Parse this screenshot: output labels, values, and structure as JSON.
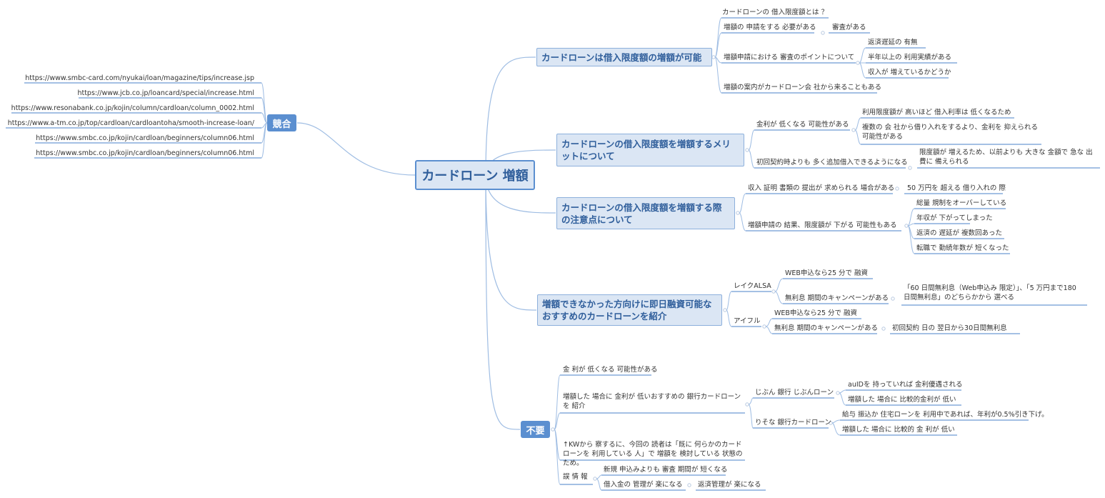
{
  "root": {
    "label": "カードローン 増額"
  },
  "competitors": {
    "label": "競合",
    "urls": [
      "https://www.smbc-card.com/nyukai/loan/magazine/tips/increase.jsp",
      "https://www.jcb.co.jp/loancard/special/increase.html",
      "https://www.resonabank.co.jp/kojin/column/cardloan/column_0002.html",
      "https://www.a-tm.co.jp/top/cardloan/cardloantoha/smooth-increase-loan/",
      "https://www.smbc.co.jp/kojin/cardloan/beginners/column06.html",
      "https://www.smbc.co.jp/kojin/cardloan/beginners/column06.html"
    ]
  },
  "b1": {
    "label": "カードローンは借入限度額の増額が可能",
    "items": [
      "カードローンの 借入限度額とは ？",
      "増額の 申請をする 必要がある",
      "審査がある",
      "増額申請における 審査のポイントについて",
      "返済遅延の 有無",
      "半年以上の 利用実績がある",
      "収入が 増えているかどうか",
      "増額の案内がカードローン会 社から来ることもある"
    ]
  },
  "b2": {
    "label": "カードローンの借入限度額を増額するメリットについて",
    "items": [
      "金利が 低くなる 可能性がある",
      "利用限度額が 高いほど 借入利率は 低くなるため",
      "複数の 会 社から借り入れをするより、金利を 抑えられる 可能性がある",
      "初回契約時よりも 多く追加借入できるようになる",
      "限度額が 増えるため、以前よりも 大きな 金額で 急な 出費に 備えられる"
    ]
  },
  "b3": {
    "label": "カードローンの借入限度額を増額する際の注意点について",
    "items": [
      "収入 証明 書類の 提出が 求められる 場合がある",
      "50 万円を 超える 借り入れの 際",
      "増額申請の 結果、限度額が 下がる 可能性もある",
      "総量 規制をオーバーしている",
      "年収が 下がってしまった",
      "返済の 遅延が 複数回あった",
      "転職で 勤続年数が 短くなった"
    ]
  },
  "b4": {
    "label": "増額できなかった方向けに即日融資可能なおすすめのカードローンを紹介",
    "items": [
      "レイクALSA",
      "WEB申込なら25 分で 融資",
      "無利息 期間のキャンペーンがある",
      "「60 日間無利息（Web申込み 限定）」、「5 万円まで180 日間無利息」のどちらかから 選べる",
      "アイフル",
      "WEB申込なら25 分で 融資",
      "無利息 期間のキャンペーンがある",
      "初回契約 日の 翌日から30日間無利息"
    ]
  },
  "unneeded": {
    "label": "不要",
    "items": [
      "金 利が 低くなる 可能性がある",
      "増額した 場合に 金利が 低いおすすめの 銀行カードローンを 紹介",
      "じぶん 銀行 じぶんローン",
      "auIDを 持っていれば 金利優遇される",
      "増額した 場合に 比較的金利が 低い",
      "りそな 銀行カードローン",
      "給与 振込か 住宅ローンを 利用中であれば、年利が0.5%引き下げ。",
      "増額した 場合に 比較的 金 利が 低い",
      "↑KWから 察するに、今回の 読者は「既に 何らかのカードローンを 利用している 人」で 増額を 検討している 状態のため。",
      "誤 情 報",
      "新規 申込みよりも 審査 期間が 短くなる",
      "借入金の 管理が 楽になる",
      "返済管理が 楽になる"
    ]
  },
  "colors": {
    "line": "#4a82c8",
    "branch": "#9fbde3",
    "accent": "#5b8fd0"
  }
}
